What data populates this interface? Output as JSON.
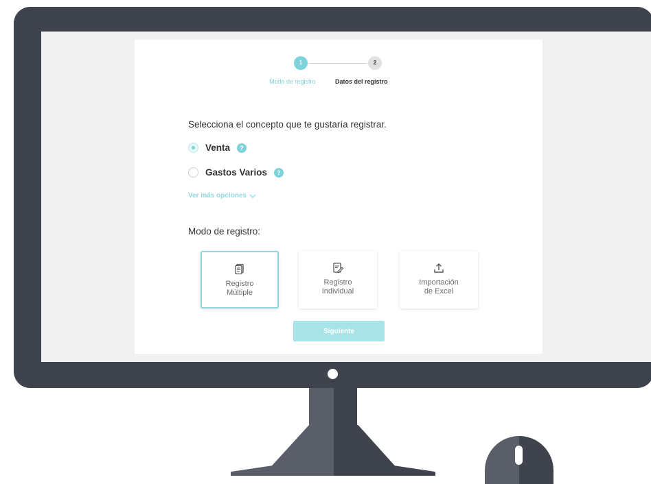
{
  "stepper": {
    "steps": [
      {
        "number": "1",
        "label": "Modo de registro",
        "active": true
      },
      {
        "number": "2",
        "label": "Datos del registro",
        "active": false
      }
    ]
  },
  "form": {
    "prompt": "Selecciona el concepto que te gustaría registrar.",
    "options": [
      {
        "label": "Venta",
        "checked": true,
        "help_icon": "question-icon"
      },
      {
        "label": "Gastos Varios",
        "checked": false,
        "help_icon": "question-icon"
      }
    ],
    "more_options_label": "Ver más opciones",
    "more_options_icon": "chevron-down-icon",
    "help_glyph": "?",
    "mode_label": "Modo de registro:",
    "mode_cards": [
      {
        "line1": "Registro",
        "line2": "Múltiple",
        "icon": "stacked-documents-icon",
        "selected": true
      },
      {
        "line1": "Registro",
        "line2": "Individual",
        "icon": "document-edit-icon",
        "selected": false
      },
      {
        "line1": "Importación",
        "line2": "de Excel",
        "icon": "upload-icon",
        "selected": false
      }
    ],
    "next_button_label": "Siguiente"
  },
  "colors": {
    "accent": "#7ed3da",
    "monitor": "#3f434d",
    "text": "#333333"
  }
}
